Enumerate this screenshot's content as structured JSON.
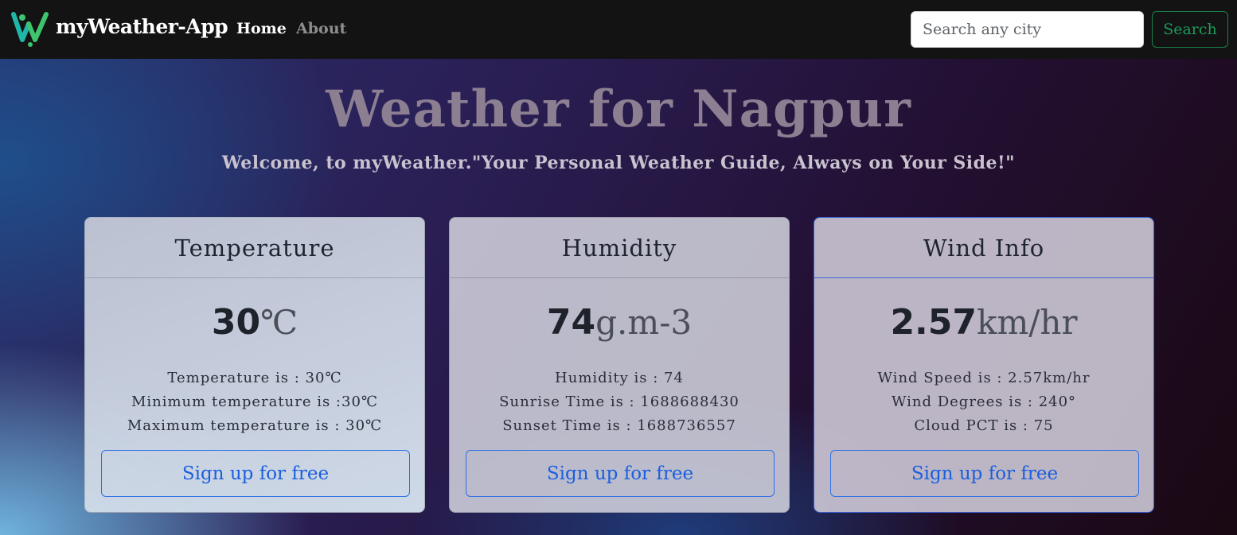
{
  "nav": {
    "brand": "myWeather-App",
    "home": "Home",
    "about": "About",
    "search_placeholder": "Search any city",
    "search_button": "Search"
  },
  "hero": {
    "title": "Weather for Nagpur",
    "tagline": "Welcome, to myWeather.\"Your Personal Weather Guide, Always on Your Side!\""
  },
  "cards": [
    {
      "header": "Temperature",
      "value": "30",
      "unit": "℃",
      "lines": [
        "Temperature is : 30℃",
        "Minimum temperature is :30℃",
        "Maximum temperature is : 30℃"
      ],
      "button": "Sign up for free"
    },
    {
      "header": "Humidity",
      "value": "74",
      "unit": "g.m-3",
      "lines": [
        "Humidity is : 74",
        "Sunrise Time is : 1688688430",
        "Sunset Time is : 1688736557"
      ],
      "button": "Sign up for free"
    },
    {
      "header": "Wind Info",
      "value": "2.57",
      "unit": "km/hr",
      "lines": [
        "Wind Speed is : 2.57km/hr",
        "Wind Degrees is : 240°",
        "Cloud PCT is : 75"
      ],
      "button": "Sign up for free"
    }
  ],
  "colors": {
    "navbar": "#131313",
    "search_button": "#1c9a5a",
    "signup_button": "#1a5fe0",
    "logo_teal": "#1fb8a8",
    "logo_green": "#3ec46d"
  }
}
